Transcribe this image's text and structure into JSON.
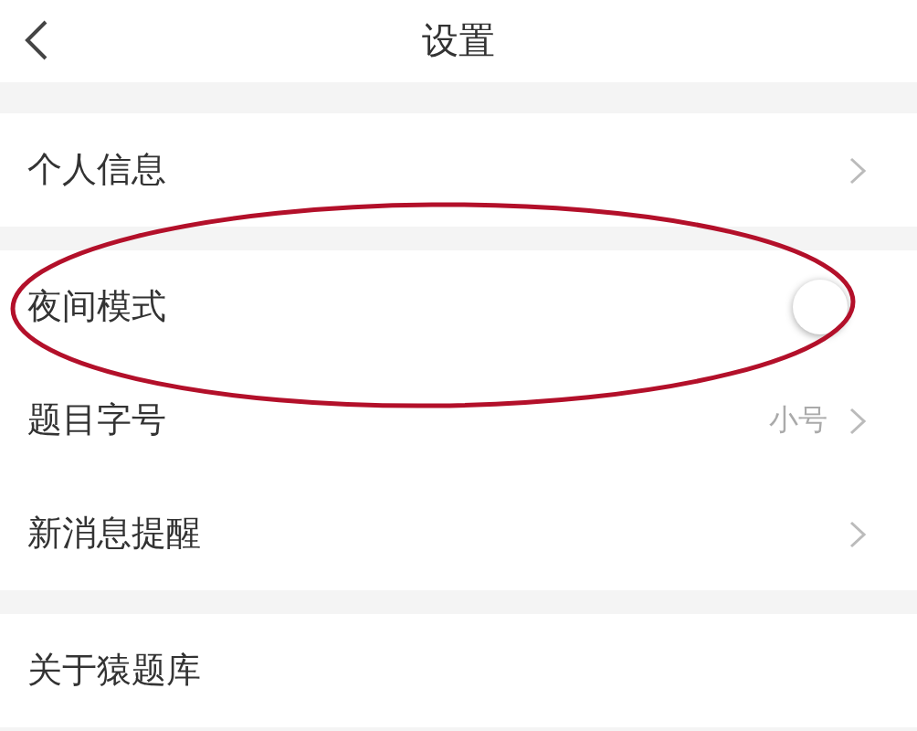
{
  "header": {
    "title": "设置"
  },
  "sections": [
    {
      "rows": [
        {
          "kind": "link",
          "label": "个人信息"
        }
      ]
    },
    {
      "rows": [
        {
          "kind": "toggle",
          "label": "夜间模式",
          "on": false
        },
        {
          "kind": "value",
          "label": "题目字号",
          "value": "小号"
        },
        {
          "kind": "link",
          "label": "新消息提醒"
        }
      ]
    },
    {
      "rows": [
        {
          "kind": "plain",
          "label": "关于猿题库"
        }
      ]
    }
  ],
  "annotations": [
    {
      "kind": "ellipse"
    }
  ]
}
